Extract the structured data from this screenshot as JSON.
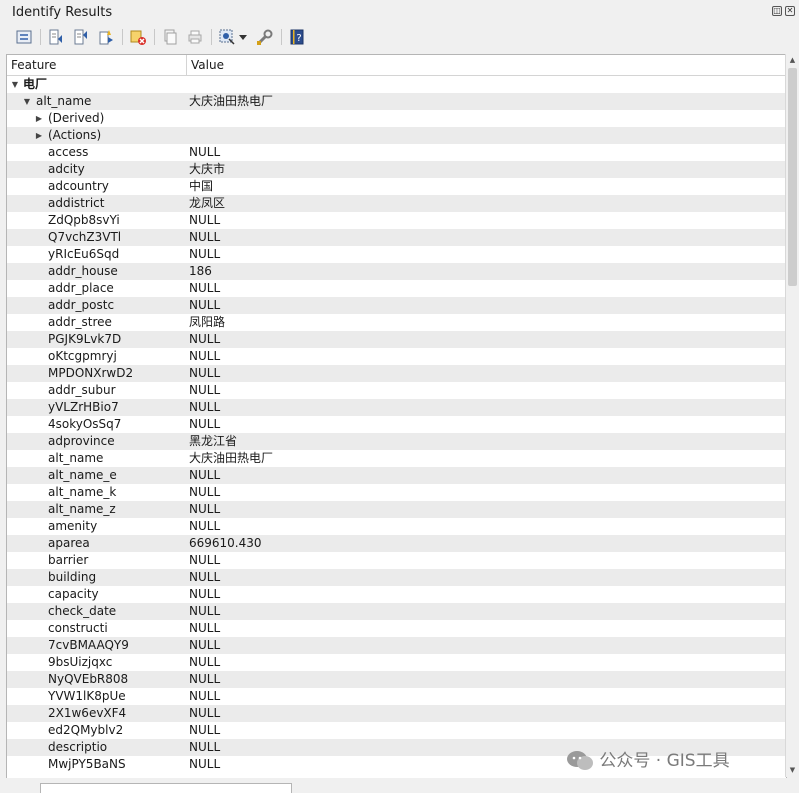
{
  "window": {
    "title": "Identify Results"
  },
  "header": {
    "feature": "Feature",
    "value": "Value"
  },
  "tree": {
    "layer": "电厂",
    "feature_field": "alt_name",
    "feature_value": "大庆油田热电厂",
    "groups": [
      "(Derived)",
      "(Actions)"
    ]
  },
  "attributes": [
    {
      "f": "access",
      "v": "NULL"
    },
    {
      "f": "adcity",
      "v": "大庆市"
    },
    {
      "f": "adcountry",
      "v": "中国"
    },
    {
      "f": "addistrict",
      "v": "龙凤区"
    },
    {
      "f": "ZdQpb8svYi",
      "v": "NULL"
    },
    {
      "f": "Q7vchZ3VTl",
      "v": "NULL"
    },
    {
      "f": "yRIcEu6Sqd",
      "v": "NULL"
    },
    {
      "f": "addr_house",
      "v": "186"
    },
    {
      "f": "addr_place",
      "v": "NULL"
    },
    {
      "f": "addr_postc",
      "v": "NULL"
    },
    {
      "f": "addr_stree",
      "v": "凤阳路"
    },
    {
      "f": "PGJK9Lvk7D",
      "v": "NULL"
    },
    {
      "f": "oKtcgpmryj",
      "v": "NULL"
    },
    {
      "f": "MPDONXrwD2",
      "v": "NULL"
    },
    {
      "f": "addr_subur",
      "v": "NULL"
    },
    {
      "f": "yVLZrHBio7",
      "v": "NULL"
    },
    {
      "f": "4sokyOsSq7",
      "v": "NULL"
    },
    {
      "f": "adprovince",
      "v": "黑龙江省"
    },
    {
      "f": "alt_name",
      "v": "大庆油田热电厂"
    },
    {
      "f": "alt_name_e",
      "v": "NULL"
    },
    {
      "f": "alt_name_k",
      "v": "NULL"
    },
    {
      "f": "alt_name_z",
      "v": "NULL"
    },
    {
      "f": "amenity",
      "v": "NULL"
    },
    {
      "f": "aparea",
      "v": "669610.430"
    },
    {
      "f": "barrier",
      "v": "NULL"
    },
    {
      "f": "building",
      "v": "NULL"
    },
    {
      "f": "capacity",
      "v": "NULL"
    },
    {
      "f": "check_date",
      "v": "NULL"
    },
    {
      "f": "constructi",
      "v": "NULL"
    },
    {
      "f": "7cvBMAAQY9",
      "v": "NULL"
    },
    {
      "f": "9bsUizjqxc",
      "v": "NULL"
    },
    {
      "f": "NyQVEbR808",
      "v": "NULL"
    },
    {
      "f": "YVW1lK8pUe",
      "v": "NULL"
    },
    {
      "f": "2X1w6evXF4",
      "v": "NULL"
    },
    {
      "f": "ed2QMyblv2",
      "v": "NULL"
    },
    {
      "f": "descriptio",
      "v": "NULL"
    },
    {
      "f": "MwjPY5BaNS",
      "v": "NULL"
    }
  ],
  "watermark": {
    "text": "公众号 · GIS工具"
  },
  "icons": {
    "toolbar": [
      "expand-tree-icon",
      "collapse-all-icon",
      "expand-all-icon",
      "expand-new-icon",
      "clear-results-icon",
      "copy-feature-icon",
      "print-icon",
      "identify-mode-icon",
      "dropdown-arrow-icon",
      "settings-wrench-icon",
      "help-icon"
    ]
  },
  "colors": {
    "row_alt": "#ebebeb",
    "accent_blue": "#2f5fa8",
    "accent_yellow": "#e8b323"
  }
}
